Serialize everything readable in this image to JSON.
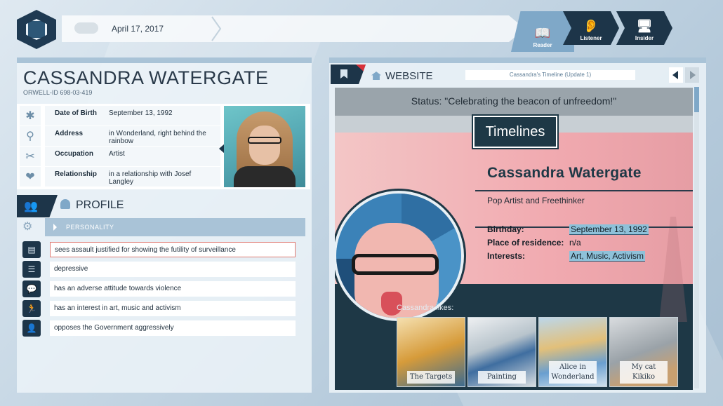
{
  "header": {
    "date": "April 17, 2017",
    "modes": [
      {
        "label": "Reader",
        "icon": "book-icon"
      },
      {
        "label": "Listener",
        "icon": "ear-icon"
      },
      {
        "label": "Insider",
        "icon": "monitor-icon"
      }
    ]
  },
  "citizen": {
    "name": "CASSANDRA WATERGATE",
    "orwell_id": "ORWELL-ID  698-03-419",
    "facts": [
      {
        "key": "Date of Birth",
        "value": "September 13, 1992",
        "icon": "asterisk-icon"
      },
      {
        "key": "Address",
        "value": "in Wonderland, right behind the rainbow",
        "icon": "location-pin-icon"
      },
      {
        "key": "Occupation",
        "value": "Artist",
        "icon": "tools-icon"
      },
      {
        "key": "Relationship",
        "value": "in a relationship with Josef Langley",
        "icon": "hearts-icon"
      }
    ]
  },
  "profile": {
    "title": "PROFILE",
    "category": "PERSONALITY",
    "traits": [
      {
        "text": "sees assault justified for showing the futility of surveillance",
        "icon": "book-icon",
        "selected": true
      },
      {
        "text": "depressive",
        "icon": "notebook-icon",
        "selected": false
      },
      {
        "text": "has an adverse attitude towards violence",
        "icon": "speech-bubble-icon",
        "selected": false
      },
      {
        "text": "has an interest in art, music and activism",
        "icon": "running-person-icon",
        "selected": false
      },
      {
        "text": "opposes the Government aggressively",
        "icon": "person-icon",
        "selected": false
      }
    ]
  },
  "website": {
    "label": "WEBSITE",
    "timeline_title": "Cassandra's Timeline (Update 1)",
    "status": "Status: \"Celebrating the beacon of unfreedom!\"",
    "badge": "Timelines",
    "name": "Cassandra Watergate",
    "tagline": "Pop Artist and Freethinker",
    "info": [
      {
        "key": "Birthday:",
        "value": "September 13, 1992",
        "highlight": true
      },
      {
        "key": "Place of residence:",
        "value": "n/a",
        "highlight": false
      },
      {
        "key": "Interests:",
        "value": "Art, Music, Activism",
        "highlight": true
      }
    ],
    "likes_label": "Cassandra likes:",
    "likes": [
      {
        "caption": "The Targets"
      },
      {
        "caption": "Painting"
      },
      {
        "caption": "Alice in Wonderland"
      },
      {
        "caption": "My cat Kikiko"
      }
    ]
  }
}
